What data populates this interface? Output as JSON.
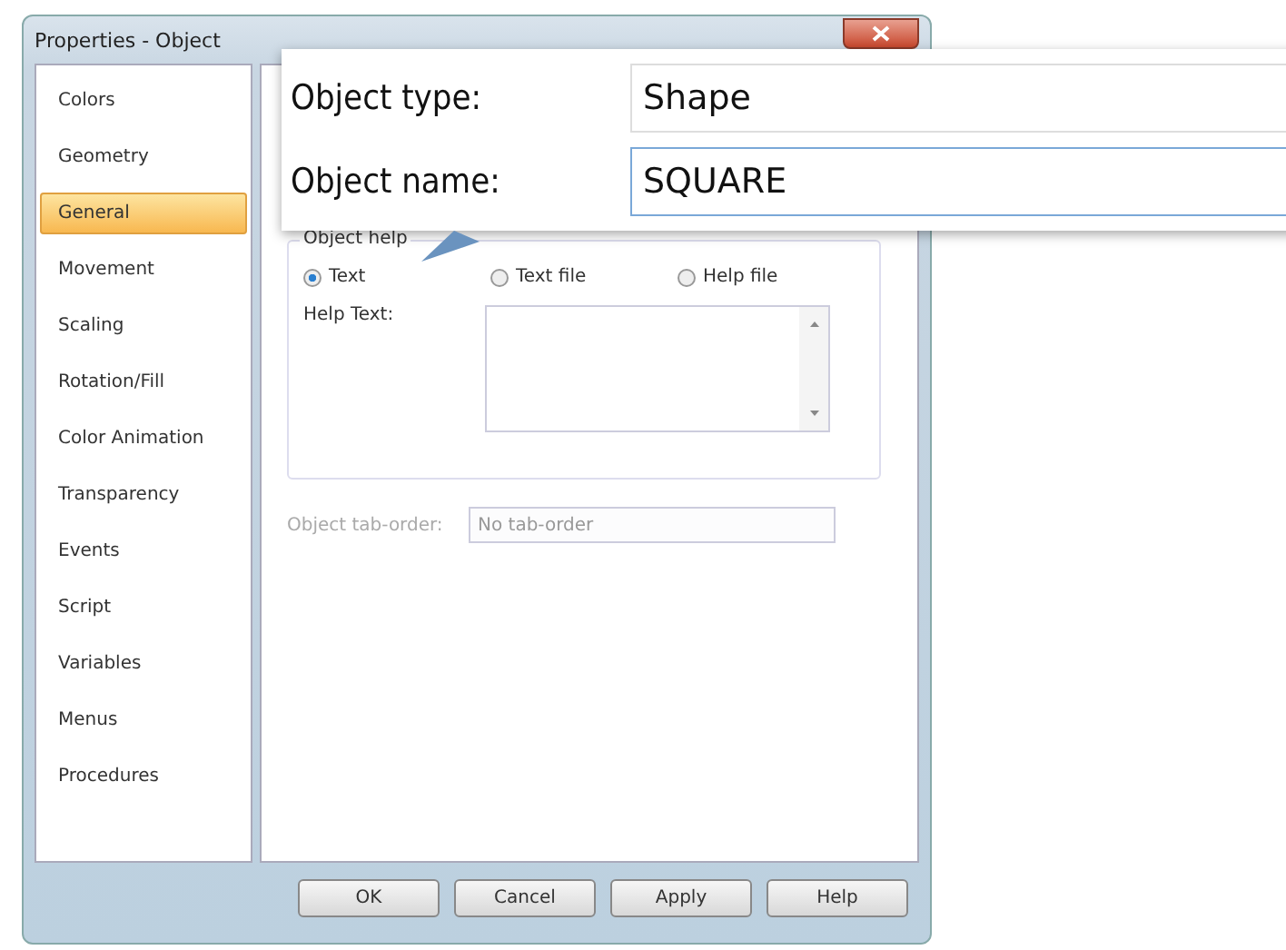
{
  "window": {
    "title": "Properties - Object"
  },
  "sidebar": {
    "items": [
      {
        "label": "Colors",
        "selected": false
      },
      {
        "label": "Geometry",
        "selected": false
      },
      {
        "label": "General",
        "selected": true
      },
      {
        "label": "Movement",
        "selected": false
      },
      {
        "label": "Scaling",
        "selected": false
      },
      {
        "label": "Rotation/Fill",
        "selected": false
      },
      {
        "label": "Color Animation",
        "selected": false
      },
      {
        "label": "Transparency",
        "selected": false
      },
      {
        "label": "Events",
        "selected": false
      },
      {
        "label": "Script",
        "selected": false
      },
      {
        "label": "Variables",
        "selected": false
      },
      {
        "label": "Menus",
        "selected": false
      },
      {
        "label": "Procedures",
        "selected": false
      }
    ]
  },
  "help_group": {
    "title": "Object help",
    "options": [
      {
        "label": "Text",
        "selected": true
      },
      {
        "label": "Text file",
        "selected": false
      },
      {
        "label": "Help file",
        "selected": false
      }
    ],
    "help_text_label": "Help Text:"
  },
  "tab_order": {
    "label": "Object tab-order:",
    "placeholder": "No tab-order",
    "disabled": true
  },
  "buttons": [
    "OK",
    "Cancel",
    "Apply",
    "Help"
  ],
  "callout": {
    "fields": [
      {
        "label": "Object type:",
        "value": "Shape",
        "focused": false
      },
      {
        "label": "Object name:",
        "value": "SQUARE",
        "focused": true
      }
    ]
  }
}
